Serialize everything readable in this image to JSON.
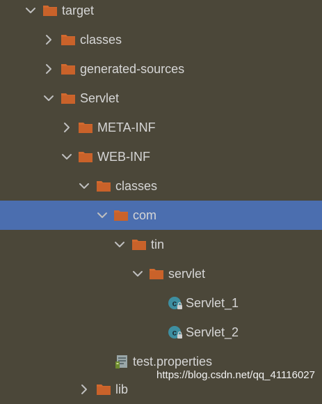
{
  "tree": {
    "items": [
      {
        "label": "target",
        "type": "folder",
        "expanded": true,
        "icon": "folder-icon"
      },
      {
        "label": "classes",
        "type": "folder",
        "expanded": false,
        "icon": "folder-icon"
      },
      {
        "label": "generated-sources",
        "type": "folder",
        "expanded": false,
        "icon": "folder-icon"
      },
      {
        "label": "Servlet",
        "type": "folder",
        "expanded": true,
        "icon": "folder-icon"
      },
      {
        "label": "META-INF",
        "type": "folder",
        "expanded": false,
        "icon": "folder-icon"
      },
      {
        "label": "WEB-INF",
        "type": "folder",
        "expanded": true,
        "icon": "folder-icon"
      },
      {
        "label": "classes",
        "type": "folder",
        "expanded": true,
        "icon": "folder-icon"
      },
      {
        "label": "com",
        "type": "folder",
        "expanded": true,
        "selected": true,
        "icon": "folder-icon"
      },
      {
        "label": "tin",
        "type": "folder",
        "expanded": true,
        "icon": "folder-icon"
      },
      {
        "label": "servlet",
        "type": "folder",
        "expanded": true,
        "icon": "folder-icon"
      },
      {
        "label": "Servlet_1",
        "type": "class",
        "icon": "java-class-icon"
      },
      {
        "label": "Servlet_2",
        "type": "class",
        "icon": "java-class-icon"
      },
      {
        "label": "test.properties",
        "type": "file",
        "icon": "properties-file-icon"
      },
      {
        "label": "lib",
        "type": "folder",
        "expanded": false,
        "icon": "folder-icon"
      }
    ]
  },
  "watermark": "https://blog.csdn.net/qq_41116027",
  "colors": {
    "background": "#4b4739",
    "selection": "#4b6eaf",
    "folder": "#d2692e",
    "text": "#d6d6d6",
    "class_icon": "#3e8fa1"
  }
}
